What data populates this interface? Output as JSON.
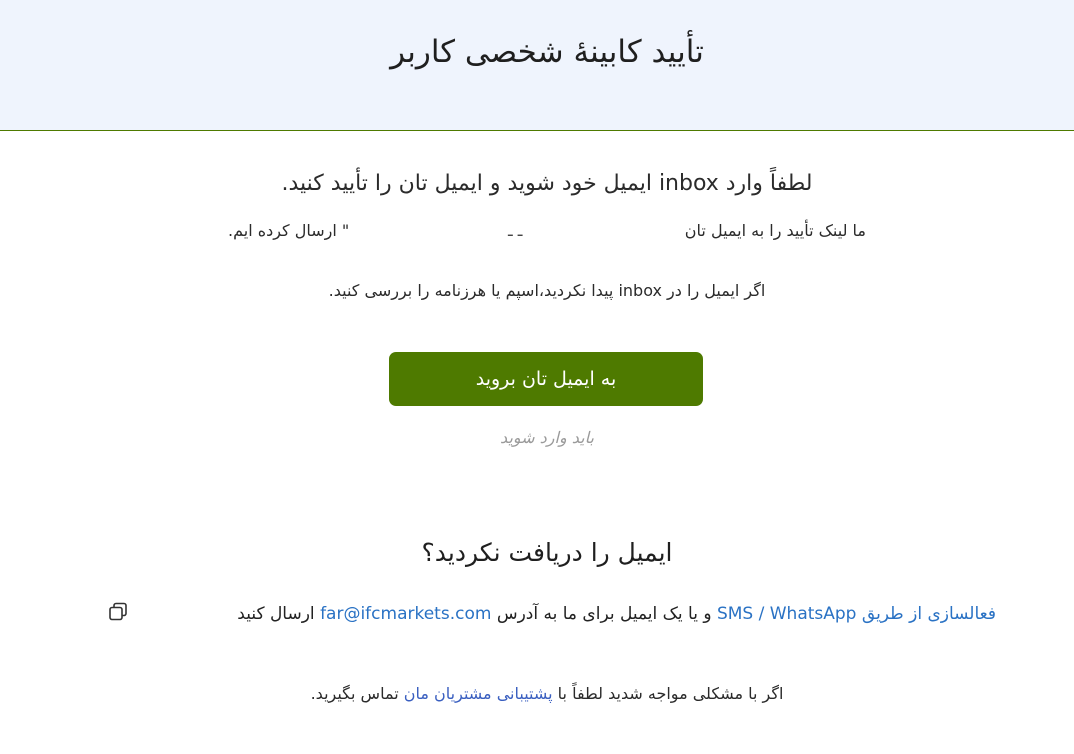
{
  "header": {
    "title": "تأیید کابینهٔ شخصی کاربر"
  },
  "main": {
    "heading": "لطفاً وارد inbox ایمیل خود شوید و ایمیل تان را تأیید کنید.",
    "sent_part1": "ما لینک تأیید را به ایمیل تان",
    "sent_masked": "ـ ـ",
    "sent_part2": "\" ارسال کرده ایم.",
    "hint": "اگر ایمیل را در inbox پیدا نکردید،اسپم یا هرزنامه را بررسی کنید.",
    "cta_label": "به ایمیل تان بروید",
    "login_required": "باید وارد شوید"
  },
  "resend": {
    "heading": "ایمیل را دریافت نکردید؟",
    "activation_link": "فعالسازی از طریق",
    "channels_link": "SMS / WhatsApp",
    "middle_text": "و یا یک ایمیل برای ما به آدرس",
    "email_link": "far@ifcmarkets.com",
    "end_text": "ارسال کنید"
  },
  "support": {
    "prefix": "اگر با مشکلی مواجه شدید لطفاً با",
    "link": "پشتیبانی مشتریان مان",
    "suffix": "تماس بگیرید."
  },
  "colors": {
    "accent_green": "#4e7a00",
    "header_bg": "#eff4fd",
    "link_blue": "#2a72c4"
  },
  "icons": {
    "copy": "copy-icon"
  }
}
